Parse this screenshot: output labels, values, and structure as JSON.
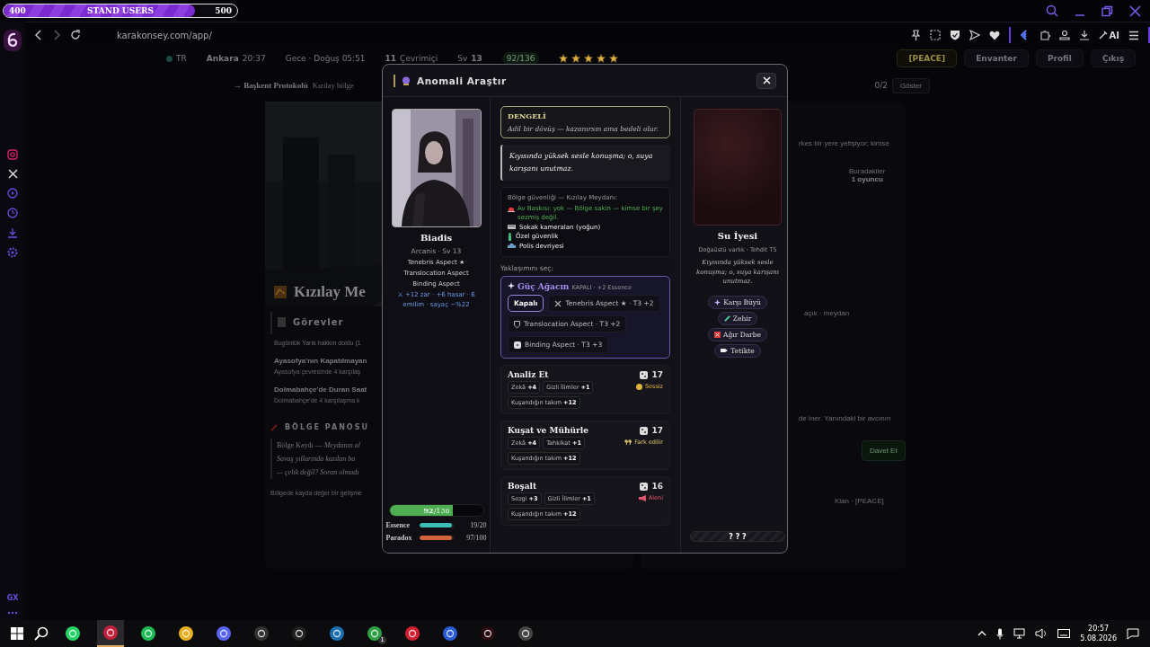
{
  "stream_overlay": {
    "min": "400",
    "label": "STAND USERS",
    "max": "500",
    "level": 0.82
  },
  "browser": {
    "url": "karakonsey.com/app/",
    "ai_label": "AI"
  },
  "opera_sidebar": {
    "badge": "GX"
  },
  "page": {
    "header": {
      "region": "TR",
      "city": "**Ankara** 20:37",
      "daytime": "Gece · Doğuş 05:51",
      "online": "**11** Çevrimiçi",
      "level": "Sv **13**",
      "health": "92/136",
      "stars": 5,
      "buttons": [
        "[PEACE]",
        "Envanter",
        "Profil",
        "Çıkış"
      ]
    },
    "breadcrumb": {
      "title": "→ Başkent Protokolü",
      "subtitle": "Kızılay bölge",
      "progress": "0/2",
      "action": "Göster"
    },
    "location": {
      "title": "Kızılay Me"
    },
    "quests": {
      "title": "Görevler",
      "note": "Bugünlük Yarık hakkın doldu (1",
      "items": [
        {
          "title": "Ayasofya'nın Kapatılmayan",
          "desc": "Ayasofya çevresinde 4 karşılaş"
        },
        {
          "title": "Dolmabahçe'de Duran Saat",
          "desc": "Dolmabahçe'de 4 karşılaşma k"
        }
      ]
    },
    "board": {
      "title": "BÖLGE PANOSU",
      "entry": "Bölge Kaydı — *Meydanın al*",
      "lines": [
        "Savaş yıllarında kazılan ba",
        "— çelik değil? Soran olmadı"
      ],
      "footer": "Bölgede kayda değer bir gelişme"
    },
    "side": {
      "intro": "rkes bir yere yetişiyor; kimse",
      "present_label": "Buradakiler",
      "present_count": "1 oyuncu",
      "place": "açık · meydan",
      "hint": "de iner. Yanındaki bir avcının",
      "invite": "Davet Et",
      "clan": "Klan · [PEACE]"
    }
  },
  "modal": {
    "title": "Anomali Araştır",
    "player": {
      "name": "Biadis",
      "class_line": "Arcanis · Sv 13",
      "aspects": [
        "Tenebris Aspect ★",
        "Translocation Aspect",
        "Binding Aspect"
      ],
      "bonus": "⚔ +12 zar · +6 hasar · 6 emilim · sayaç −%22",
      "health": {
        "value": "92",
        "max": "/136",
        "level": 0.676
      },
      "resources": [
        {
          "name": "Essence",
          "reading": "19/20",
          "level": 0.95,
          "color": "#3bbfb5"
        },
        {
          "name": "Paradox",
          "reading": "97/100",
          "level": 0.97,
          "color": "#d2643a"
        }
      ]
    },
    "mode": {
      "title": "DENGELİ",
      "desc": "Adil bir dövüş — kazanırsın ama bedeli olur."
    },
    "quote": "Kıyısında yüksek sesle konuşma; o, suya karışanı unutmaz.",
    "security": {
      "title": "Bölge güvenliği — Kızılay Meydanı:",
      "alert": "Av Baskısı: yok — Bölge sakin — kimse bir şey sezmiş değil.",
      "items": [
        {
          "kind": "camera",
          "text": "Sokak kameraları (yoğun)"
        },
        {
          "kind": "guard",
          "text": "Özel güvenlik"
        },
        {
          "kind": "police",
          "text": "Polis devriyesi"
        }
      ]
    },
    "prompt": "Yaklaşımını seç:",
    "power_tree": {
      "title": "Güç Ağacın",
      "status": "KAPALI · +2 Essence",
      "options": [
        {
          "kind": "none",
          "label": "Kapalı",
          "selected": true
        },
        {
          "kind": "swords",
          "label": "Tenebris Aspect ★ · T3 +2",
          "selected": false
        },
        {
          "kind": "shield",
          "label": "Translocation Aspect · T3 +2",
          "selected": false
        },
        {
          "kind": "die",
          "label": "Binding Aspect · T3 +3",
          "selected": false
        }
      ]
    },
    "actions": [
      {
        "title": "Analiz Et",
        "roll": "17",
        "chips": [
          "Zekâ **+4**",
          "Gizli İlimler **+1**",
          "Kuşandığın takım **+12**"
        ],
        "stealth": {
          "kind": "silent",
          "text": "Sessiz",
          "color": "#e0b43a"
        }
      },
      {
        "title": "Kuşat ve Mühürle",
        "roll": "17",
        "chips": [
          "Zekâ **+4**",
          "Tahkikat **+1**",
          "Kuşandığın takım **+12**"
        ],
        "stealth": {
          "kind": "noticed",
          "text": "Fark edilir",
          "color": "#d9c36a"
        }
      },
      {
        "title": "Boşalt",
        "roll": "16",
        "chips": [
          "Sezgi **+3**",
          "Gizli İlimler **+1**",
          "Kuşandığın takım **+12**"
        ],
        "stealth": {
          "kind": "loud",
          "text": "Aleni",
          "color": "#e0556a"
        }
      }
    ],
    "enemy": {
      "name": "Su İyesi",
      "type": "Doğaüstü varlık · Tehdit T5",
      "desc": "Kıyısında yüksek sesle konuşma; o, suya karışanı unutmaz.",
      "traits": [
        {
          "kind": "spell",
          "label": "Karşı Büyü"
        },
        {
          "kind": "poison",
          "label": "Zehir"
        },
        {
          "kind": "heavy",
          "label": "Ağır Darbe"
        },
        {
          "kind": "alert",
          "label": "Tetikte"
        }
      ],
      "reveal": "? ? ?"
    }
  },
  "taskbar": {
    "badge": "1",
    "time": "20:57",
    "date": "5.08.2026"
  }
}
